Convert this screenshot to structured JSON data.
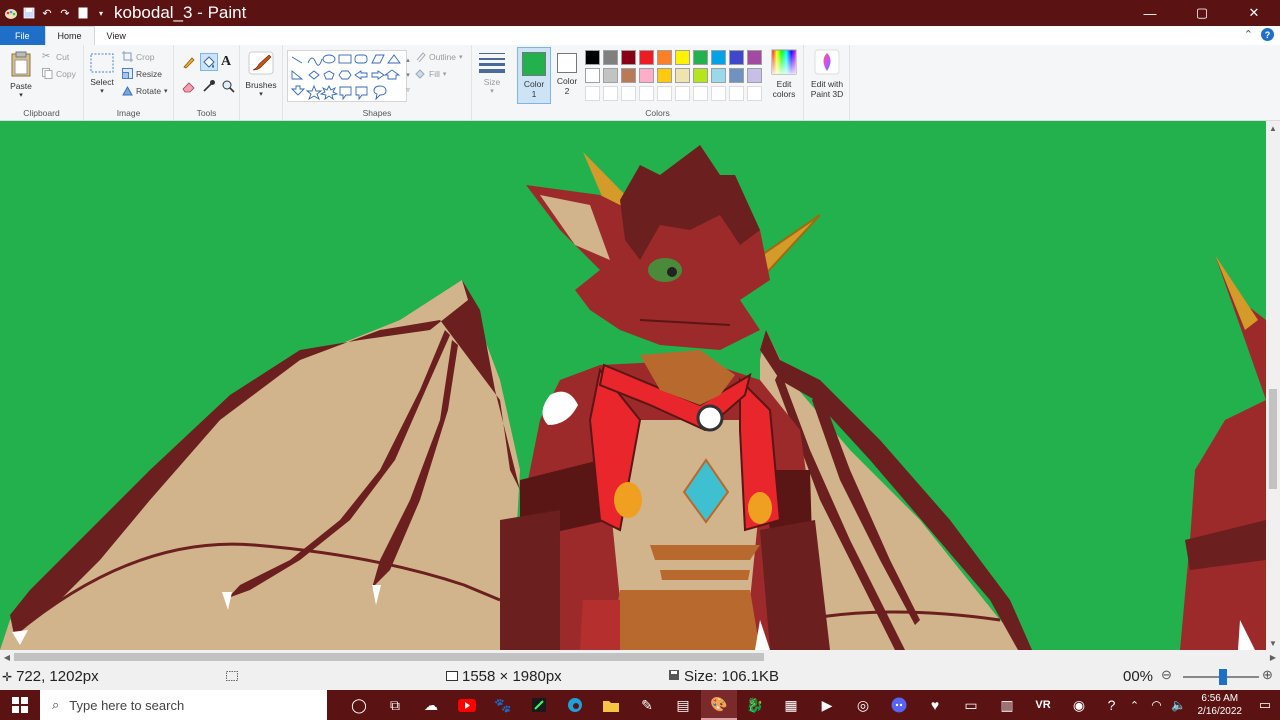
{
  "window": {
    "title": "kobodal_3 - Paint",
    "minimize": "—",
    "maximize": "▢",
    "close": "✕"
  },
  "tabs": {
    "file": "File",
    "home": "Home",
    "view": "View"
  },
  "ribbon": {
    "clipboard": {
      "label": "Clipboard",
      "paste": "Paste",
      "cut": "Cut",
      "copy": "Copy"
    },
    "image": {
      "label": "Image",
      "select": "Select",
      "crop": "Crop",
      "resize": "Resize",
      "rotate": "Rotate"
    },
    "tools": {
      "label": "Tools"
    },
    "brushes": {
      "label": "Brushes"
    },
    "shapes": {
      "label": "Shapes",
      "outline": "Outline",
      "fill": "Fill"
    },
    "size": {
      "label": "Size"
    },
    "colors": {
      "label": "Colors",
      "color1": "Color 1",
      "color1_value": "#22b14c",
      "color2": "Color 2",
      "color2_value": "#ffffff",
      "edit_colors": "Edit colors",
      "edit_paint3d": "Edit with Paint 3D",
      "palette_row1": [
        "#000000",
        "#7f7f7f",
        "#880015",
        "#ed1c24",
        "#ff7f27",
        "#fff200",
        "#22b14c",
        "#00a2e8",
        "#3f48cc",
        "#a349a4"
      ],
      "palette_row2": [
        "#ffffff",
        "#c3c3c3",
        "#b97a57",
        "#ffaec9",
        "#ffc90e",
        "#efe4b0",
        "#b5e61d",
        "#99d9ea",
        "#7092be",
        "#c8bfe7"
      ]
    }
  },
  "canvas": {
    "background": "#22b14c"
  },
  "status": {
    "cursor_pos": "722, 1202px",
    "dimensions": "1558 × 1980px",
    "size": "Size: 106.1KB",
    "zoom": "00%"
  },
  "taskbar": {
    "search_placeholder": "Type here to search",
    "time": "6:56 AM",
    "date": "2/16/2022"
  }
}
